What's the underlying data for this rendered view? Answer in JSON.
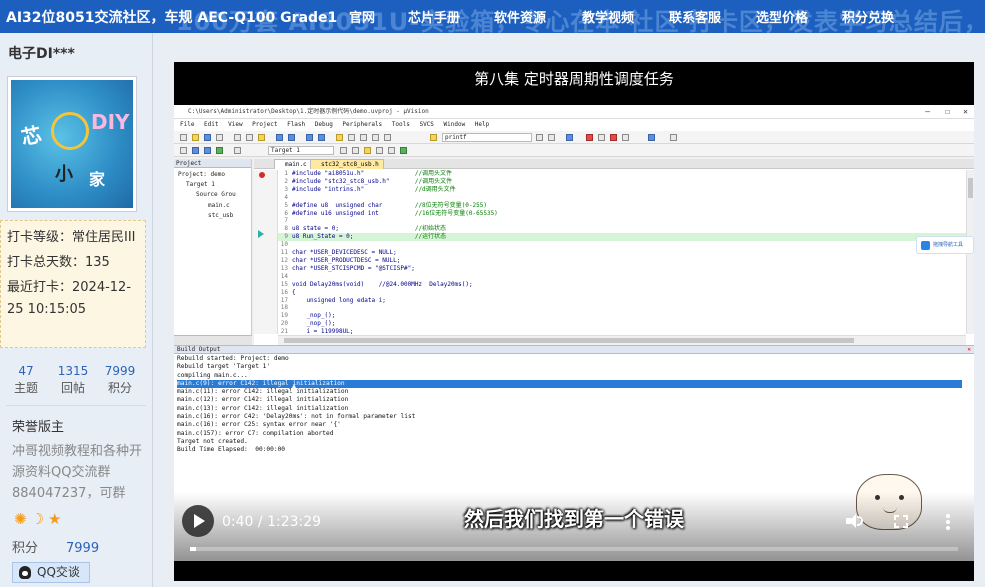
{
  "topbar": {
    "site_title": "AI32位8051交流社区，车规 AEC-Q100 Grade1",
    "bg_banner": "100万套 AI8051U-实验箱，专心在本 社区 打卡区，发表学习总结后，【免",
    "nav": [
      "官网",
      "芯片手册",
      "软件资源",
      "教学视频",
      "联系客服",
      "选型价格",
      "积分兑换"
    ]
  },
  "profile": {
    "username": "电子DI***",
    "avatar_text": [
      "芯",
      "DIY",
      "小",
      "家"
    ],
    "checkin": {
      "level": "打卡等级：常住居民III",
      "total_days": "打卡总天数：135",
      "last_checkin": "最近打卡：2024-12-25 10:15:05"
    },
    "stats": [
      {
        "value": "47",
        "label": "主题"
      },
      {
        "value": "1315",
        "label": "回帖"
      },
      {
        "value": "7999",
        "label": "积分"
      }
    ],
    "honor_title": "荣誉版主",
    "honor_desc": "冲哥视频教程和各种开源资料QQ交流群884047237，可群",
    "points_label": "积分",
    "points_value": "7999",
    "qq_button": "QQ交谈",
    "medal_icons": [
      "sun-medal-icon",
      "moon-medal-icon",
      "star-medal-icon"
    ]
  },
  "video": {
    "title": "第八集 定时器周期性调度任务",
    "subtitle": "然后我们找到第一个错误",
    "time_current": "0:40",
    "time_sep": " / ",
    "time_total": "1:23:29",
    "progress_fraction": 0.008,
    "ide": {
      "window_title": "C:\\Users\\Administrator\\Desktop\\1.定时器示例代码\\demo.uvproj - µVision",
      "menu": "File  Edit  View  Project  Flash  Debug  Peripherals  Tools  SVCS  Window  Help",
      "target": "Target 1",
      "find": "printf",
      "project_header": "Project",
      "project_tree": [
        "Project: demo",
        "Target 1",
        "Source Grou",
        "main.c",
        "stc_usb"
      ],
      "tabs": [
        "main.c",
        "stc32_stc8_usb.h"
      ],
      "notice": "拖拽导航工具",
      "build_header": "Build Output",
      "code": [
        {
          "n": "1",
          "t": "#include \"ai8051u.h\"",
          "c": "//调用头文件"
        },
        {
          "n": "2",
          "t": "#include \"stc32_stc8_usb.h\"",
          "c": "//调用头文件"
        },
        {
          "n": "3",
          "t": "#include \"intrins.h\"",
          "c": "//d调用头文件"
        },
        {
          "n": "4",
          "t": "",
          "c": ""
        },
        {
          "n": "5",
          "t": "#define u8  unsigned char",
          "c": "//8位无符号变量(0-255)"
        },
        {
          "n": "6",
          "t": "#define u16 unsigned int",
          "c": "//16位无符号变量(0-65535)"
        },
        {
          "n": "7",
          "t": "",
          "c": ""
        },
        {
          "n": "8",
          "t": "u8 state = 0;",
          "c": "//初始状态"
        },
        {
          "n": "9",
          "t": "u8 Run_State = 0;",
          "c": "//运行状态"
        },
        {
          "n": "10",
          "t": "",
          "c": ""
        },
        {
          "n": "11",
          "t": "char *USER_DEVICEDESC = NULL;",
          "c": ""
        },
        {
          "n": "12",
          "t": "char *USER_PRODUCTDESC = NULL;",
          "c": ""
        },
        {
          "n": "13",
          "t": "char *USER_STCISPCMD = \"@STCISP#\";",
          "c": ""
        },
        {
          "n": "14",
          "t": "",
          "c": ""
        },
        {
          "n": "15",
          "t": "void Delay20ms(void)    //@24.000MHz  Delay20ms();",
          "c": ""
        },
        {
          "n": "16",
          "t": "{",
          "c": ""
        },
        {
          "n": "17",
          "t": "    unsigned long edata i;",
          "c": ""
        },
        {
          "n": "18",
          "t": "",
          "c": ""
        },
        {
          "n": "19",
          "t": "    _nop_();",
          "c": ""
        },
        {
          "n": "20",
          "t": "    _nop_();",
          "c": ""
        },
        {
          "n": "21",
          "t": "    i = 119998UL;",
          "c": ""
        },
        {
          "n": "22",
          "t": "    while (i) i--;",
          "c": ""
        },
        {
          "n": "23",
          "t": "}",
          "c": ""
        },
        {
          "n": "24",
          "t": "void Timer0_Init(void)     //1毫秒@24.000MHz       //函数声明",
          "c": ""
        }
      ],
      "build": [
        "Rebuild started: Project: demo",
        "Rebuild target 'Target 1'",
        "compiling main.c...",
        "main.c(9): error C142: illegal initialization",
        "main.c(11): error C142: illegal initialization",
        "main.c(12): error C142: illegal initialization",
        "main.c(13): error C142: illegal initialization",
        "main.c(16): error C42: 'Delay20ms': not in formal parameter list",
        "main.c(16): error C25: syntax error near '{'",
        "main.c(157): error C7: compilation aborted",
        "Target not created.",
        "Build Time Elapsed:  00:00:00"
      ]
    }
  }
}
